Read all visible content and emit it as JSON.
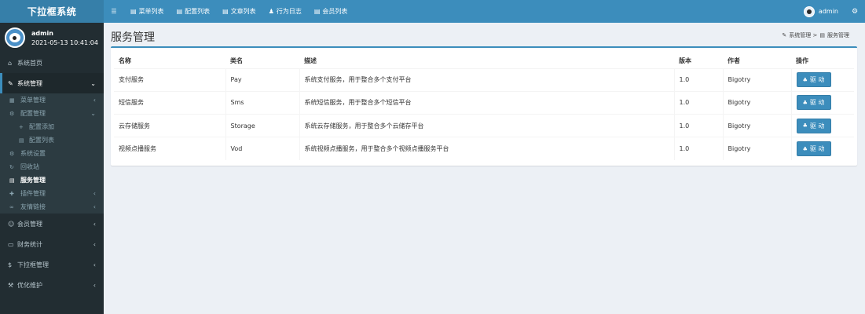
{
  "brand": "下拉框系统",
  "topnav": {
    "items": [
      {
        "label": "菜单列表",
        "icon": "list-icon"
      },
      {
        "label": "配置列表",
        "icon": "list-icon"
      },
      {
        "label": "文章列表",
        "icon": "list-icon"
      },
      {
        "label": "行为日志",
        "icon": "footprint-icon"
      },
      {
        "label": "会员列表",
        "icon": "list-icon"
      }
    ],
    "user": "admin"
  },
  "sidebar": {
    "user": {
      "name": "admin",
      "datetime": "2021-05-13 10:41:04"
    },
    "items": {
      "home": "系统首页",
      "system": "系统管理",
      "menu": "菜单管理",
      "config": "配置管理",
      "config_add": "配置添加",
      "config_list": "配置列表",
      "settings": "系统设置",
      "recycle": "回收站",
      "service": "服务管理",
      "plugin": "插件管理",
      "links": "友情链接",
      "member": "会员管理",
      "finance": "财务统计",
      "dropdown": "下拉框管理",
      "optimize": "优化维护"
    }
  },
  "page": {
    "title": "服务管理",
    "breadcrumb": {
      "parent": "系统管理 >",
      "current": "服务管理"
    }
  },
  "table": {
    "headers": [
      "名称",
      "类名",
      "描述",
      "版本",
      "作者",
      "操作"
    ],
    "rows": [
      {
        "name": "支付服务",
        "class": "Pay",
        "desc": "系统支付服务，用于整合多个支付平台",
        "version": "1.0",
        "author": "Bigotry",
        "action": "驱 动"
      },
      {
        "name": "短信服务",
        "class": "Sms",
        "desc": "系统短信服务，用于整合多个短信平台",
        "version": "1.0",
        "author": "Bigotry",
        "action": "驱 动"
      },
      {
        "name": "云存储服务",
        "class": "Storage",
        "desc": "系统云存储服务，用于整合多个云储存平台",
        "version": "1.0",
        "author": "Bigotry",
        "action": "驱 动"
      },
      {
        "name": "视频点播服务",
        "class": "Vod",
        "desc": "系统视频点播服务，用于整合多个视频点播服务平台",
        "version": "1.0",
        "author": "Bigotry",
        "action": "驱 动"
      }
    ]
  },
  "colors": {
    "accent": "#3c8dbc",
    "sidebar": "#222d32",
    "logo_bg": "#367fa9"
  }
}
